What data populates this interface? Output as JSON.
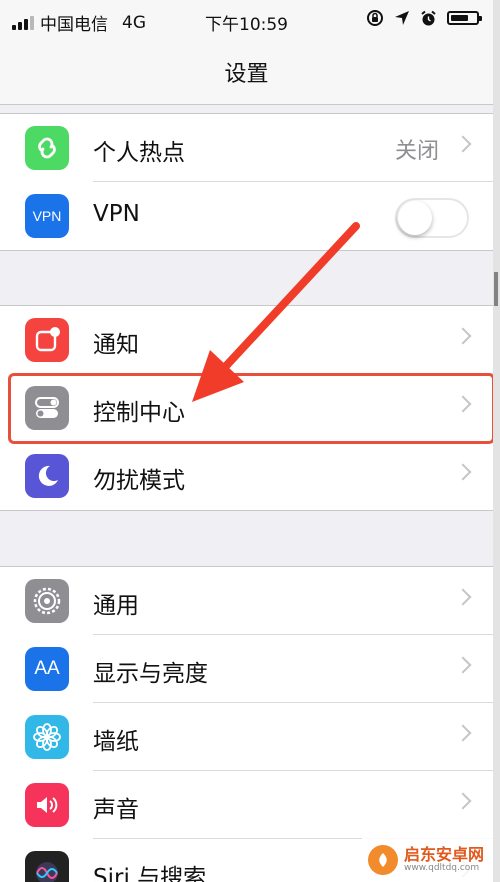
{
  "status_bar": {
    "carrier": "中国电信",
    "network": "4G",
    "time": "下午10:59"
  },
  "nav": {
    "title": "设置"
  },
  "groups": [
    {
      "items": [
        {
          "label": "个人热点",
          "value": "关闭",
          "icon": "hotspot-icon",
          "icon_color": "#4cd964"
        },
        {
          "label": "VPN",
          "icon_text": "VPN",
          "icon": "vpn-icon",
          "icon_color": "#1a73e8",
          "toggle_on": false
        }
      ]
    },
    {
      "items": [
        {
          "label": "通知",
          "icon": "notification-icon",
          "icon_color": "#f5433f"
        },
        {
          "label": "控制中心",
          "icon": "control-center-icon",
          "icon_color": "#8e8e93"
        },
        {
          "label": "勿扰模式",
          "icon": "moon-icon",
          "icon_color": "#5856d6"
        }
      ]
    },
    {
      "items": [
        {
          "label": "通用",
          "icon": "gear-icon",
          "icon_color": "#8e8e93"
        },
        {
          "label": "显示与亮度",
          "icon_text": "AA",
          "icon": "display-icon",
          "icon_color": "#1a73e8"
        },
        {
          "label": "墙纸",
          "icon": "wallpaper-icon",
          "icon_color": "#32b8e6"
        },
        {
          "label": "声音",
          "icon": "sound-icon",
          "icon_color": "#f5335b"
        },
        {
          "label": "Siri 与搜索",
          "icon": "siri-icon",
          "icon_color": "#222222"
        }
      ]
    }
  ],
  "annotation": {
    "highlight_color": "#e8503b"
  },
  "watermark": {
    "name": "启东安卓网",
    "url": "www.qdltdq.com"
  }
}
